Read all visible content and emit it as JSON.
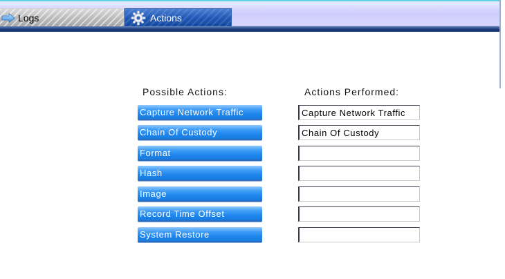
{
  "tabs": {
    "logs": {
      "label": "Logs",
      "icon": "arrow-right-icon"
    },
    "actions": {
      "label": "Actions",
      "icon": "gear-icon"
    }
  },
  "headings": {
    "possible": "Possible Actions:",
    "performed": "Actions Performed:"
  },
  "possible_actions": [
    "Capture Network Traffic",
    "Chain Of Custody",
    "Format",
    "Hash",
    "Image",
    "Record Time Offset",
    "System Restore"
  ],
  "performed_actions": [
    "Capture Network Traffic",
    "Chain Of Custody",
    "",
    "",
    "",
    "",
    ""
  ],
  "colors": {
    "button_blue": "#1f86ee",
    "tab_active": "#2159b8",
    "tab_bar": "#d7d6fd",
    "tab_baseline": "#0f2f6e"
  }
}
